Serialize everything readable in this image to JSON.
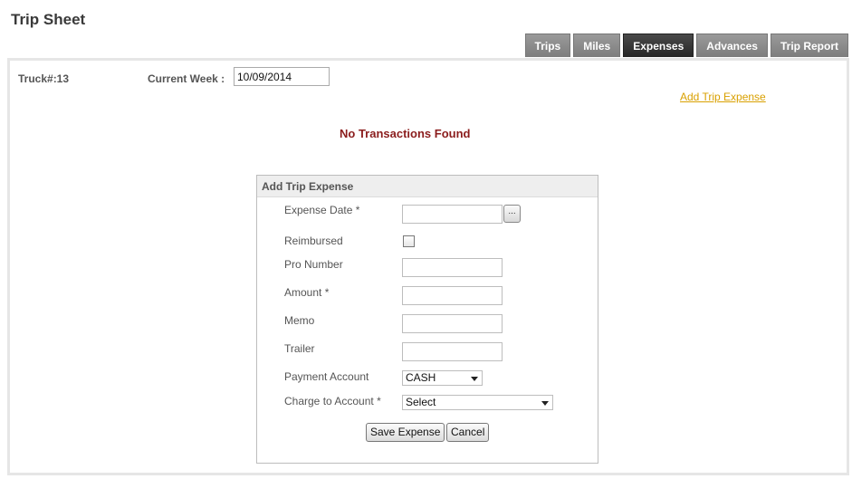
{
  "page": {
    "title": "Trip Sheet"
  },
  "tabs": [
    {
      "label": "Trips",
      "active": false
    },
    {
      "label": "Miles",
      "active": false
    },
    {
      "label": "Expenses",
      "active": true
    },
    {
      "label": "Advances",
      "active": false
    },
    {
      "label": "Trip Report",
      "active": false
    }
  ],
  "header": {
    "truck_label": "Truck#:13",
    "week_label": "Current Week :",
    "week_value": "10/09/2014",
    "add_expense_link": "Add Trip Expense"
  },
  "status": {
    "message": "No Transactions Found"
  },
  "form": {
    "title": "Add Trip Expense",
    "expense_date_label": "Expense Date *",
    "expense_date_value": "",
    "date_picker_label": "...",
    "reimbursed_label": "Reimbursed",
    "reimbursed_checked": false,
    "pro_number_label": "Pro Number",
    "amount_label": "Amount *",
    "memo_label": "Memo",
    "trailer_label": "Trailer",
    "payment_account_label": "Payment Account",
    "payment_account_value": "CASH",
    "charge_account_label": "Charge to Account *",
    "charge_account_value": "Select",
    "save_label": "Save Expense",
    "cancel_label": "Cancel"
  }
}
